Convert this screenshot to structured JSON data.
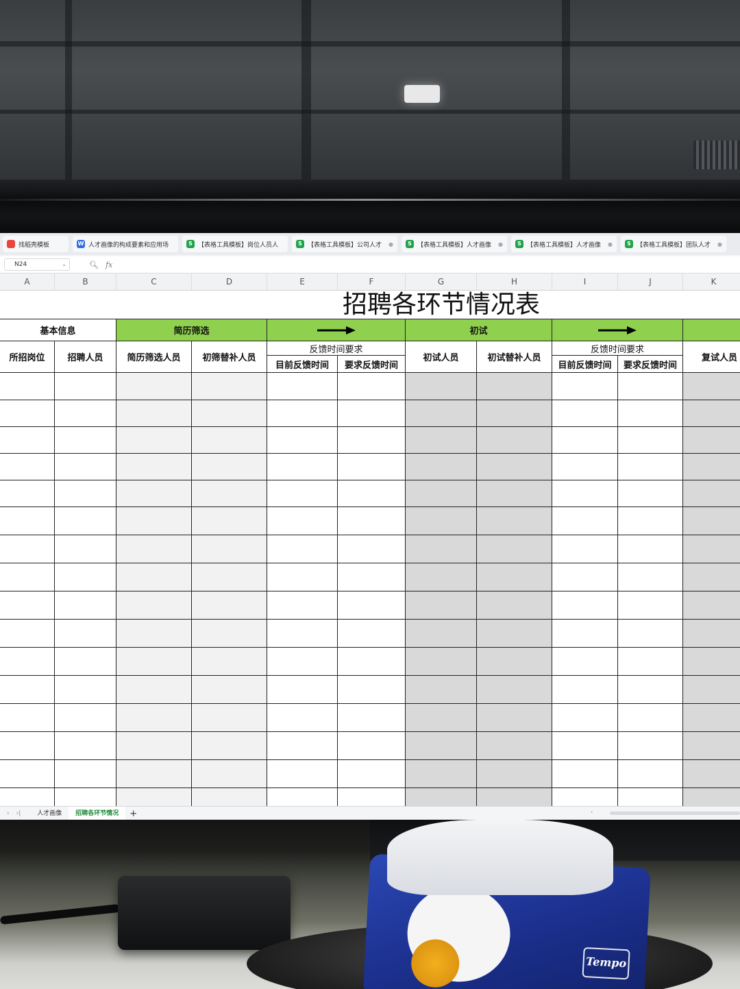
{
  "browser_tabs": [
    {
      "icon": "wps-docer-icon",
      "icon_glyph": "",
      "icon_color": "#e8453c",
      "title": "找稻壳模板"
    },
    {
      "icon": "word-doc-icon",
      "icon_glyph": "W",
      "icon_color": "#2f6fe4",
      "title": "人才画像的构成要素和应用场"
    },
    {
      "icon": "sheet-icon",
      "icon_glyph": "S",
      "icon_color": "#1fa34a",
      "title": "【表格工具模板】岗位人员人"
    },
    {
      "icon": "sheet-icon",
      "icon_glyph": "S",
      "icon_color": "#1fa34a",
      "title": "【表格工具模板】公司人才"
    },
    {
      "icon": "sheet-icon",
      "icon_glyph": "S",
      "icon_color": "#1fa34a",
      "title": "【表格工具模板】人才画像"
    },
    {
      "icon": "sheet-icon",
      "icon_glyph": "S",
      "icon_color": "#1fa34a",
      "title": "【表格工具模板】人才画像"
    },
    {
      "icon": "sheet-icon",
      "icon_glyph": "S",
      "icon_color": "#1fa34a",
      "title": "【表格工具模板】团队人才"
    }
  ],
  "formula_bar": {
    "name_box": "N24",
    "fx_label": "fx",
    "formula": ""
  },
  "column_headers": [
    "A",
    "B",
    "C",
    "D",
    "E",
    "F",
    "G",
    "H",
    "I",
    "J",
    "K"
  ],
  "sheet": {
    "title": "招聘各环节情况表",
    "groups": {
      "basic_info": "基本信息",
      "resume_screening": "简历筛选",
      "first_interview": "初试"
    },
    "headers": {
      "position": "所招岗位",
      "recruiter": "招聘人员",
      "screened": "简历筛选人员",
      "screen_substitute": "初筛替补人员",
      "feedback_req": "反馈时间要求",
      "current_feedback": "目前反馈时间",
      "required_feedback": "要求反馈时间",
      "first_interviewee": "初试人员",
      "first_substitute": "初试替补人员",
      "second_interviewee": "复试人员"
    },
    "colors": {
      "group_green": "#8fd14f",
      "shade_light": "#f2f2f2",
      "shade_dark": "#d9d9d9",
      "grid_line": "#222222"
    }
  },
  "sheet_tabs": [
    {
      "label": "人才画像",
      "active": false
    },
    {
      "label": "招聘各环节情况",
      "active": true
    }
  ],
  "add_sheet_label": "+"
}
